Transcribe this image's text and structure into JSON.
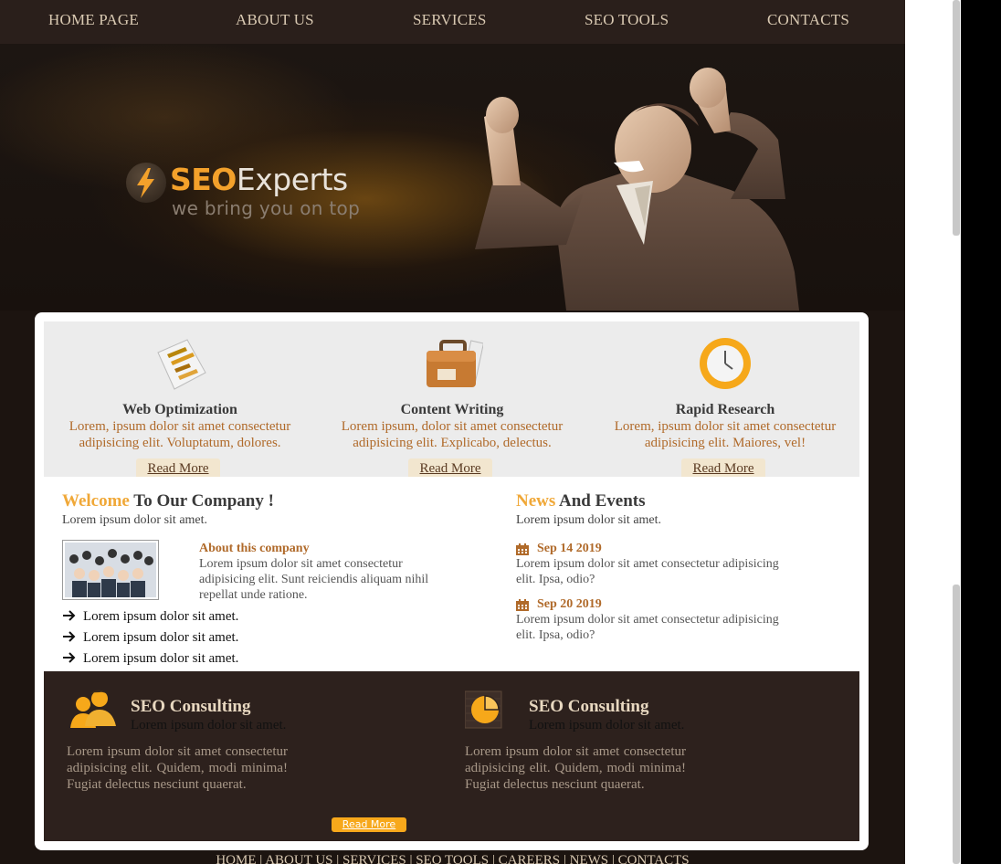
{
  "nav": {
    "items": [
      {
        "label": "HOME PAGE"
      },
      {
        "label": "ABOUT US"
      },
      {
        "label": "SERVICES"
      },
      {
        "label": "SEO TOOLS"
      },
      {
        "label": "CONTACTS"
      }
    ]
  },
  "hero": {
    "brand_seo": "SEO",
    "brand_experts": "Experts",
    "tagline": "we bring you on top"
  },
  "features": [
    {
      "title": "Web Optimization",
      "text": "Lorem, ipsum dolor sit amet consectetur adipisicing elit. Voluptatum, dolores.",
      "button": "Read More",
      "icon": "chart-doc-icon"
    },
    {
      "title": "Content Writing",
      "text": "Lorem ipsum, dolor sit amet consectetur adipisicing elit. Explicabo, delectus.",
      "button": "Read More",
      "icon": "briefcase-icon"
    },
    {
      "title": "Rapid Research",
      "text": "Lorem, ipsum dolor sit amet consectetur adipisicing elit. Maiores, vel!",
      "button": "Read More",
      "icon": "clock-icon"
    }
  ],
  "welcome": {
    "title_accent": "Welcome",
    "title_rest": "To Our Company !",
    "subtitle": "Lorem ipsum dolor sit amet.",
    "about_title": "About this company",
    "about_text": "Lorem ipsum dolor sit amet consectetur adipisicing elit. Sunt reiciendis aliquam nihil repellat unde ratione.",
    "bullets": [
      "Lorem ipsum dolor sit amet.",
      "Lorem ipsum dolor sit amet.",
      "Lorem ipsum dolor sit amet."
    ]
  },
  "news": {
    "title_accent": "News",
    "title_rest": "And Events",
    "subtitle": "Lorem ipsum dolor sit amet.",
    "events": [
      {
        "date": "Sep 14 2019",
        "text": "Lorem ipsum dolor sit amet consectetur adipisicing elit. Ipsa, odio?"
      },
      {
        "date": "Sep 20 2019",
        "text": "Lorem ipsum dolor sit amet consectetur adipisicing elit. Ipsa, odio?"
      }
    ]
  },
  "consulting": {
    "blocks": [
      {
        "title": "SEO Consulting",
        "subtitle": "Lorem ipsum dolor sit amet.",
        "text": "Lorem ipsum dolor sit amet consectetur adipisicing elit. Quidem, modi minima! Fugiat delectus nesciunt quaerat.",
        "icon": "people-icon"
      },
      {
        "title": "SEO Consulting",
        "subtitle": "Lorem ipsum dolor sit amet.",
        "text": "Lorem ipsum dolor sit amet consectetur adipisicing elit. Quidem, modi minima! Fugiat delectus nesciunt quaerat.",
        "icon": "pie-chart-icon"
      }
    ],
    "button": "Read More"
  },
  "footer": {
    "links": [
      "HOME",
      "ABOUT US",
      "SERVICES",
      "SEO TOOLS",
      "CAREERS",
      "NEWS",
      "CONTACTS"
    ],
    "separator": " | "
  },
  "colors": {
    "accent": "#f0a838",
    "link_brown": "#b06a2a",
    "dark_bg": "#1c1410",
    "panel_bg": "#2d211d",
    "button_orange": "#f7a81b"
  }
}
